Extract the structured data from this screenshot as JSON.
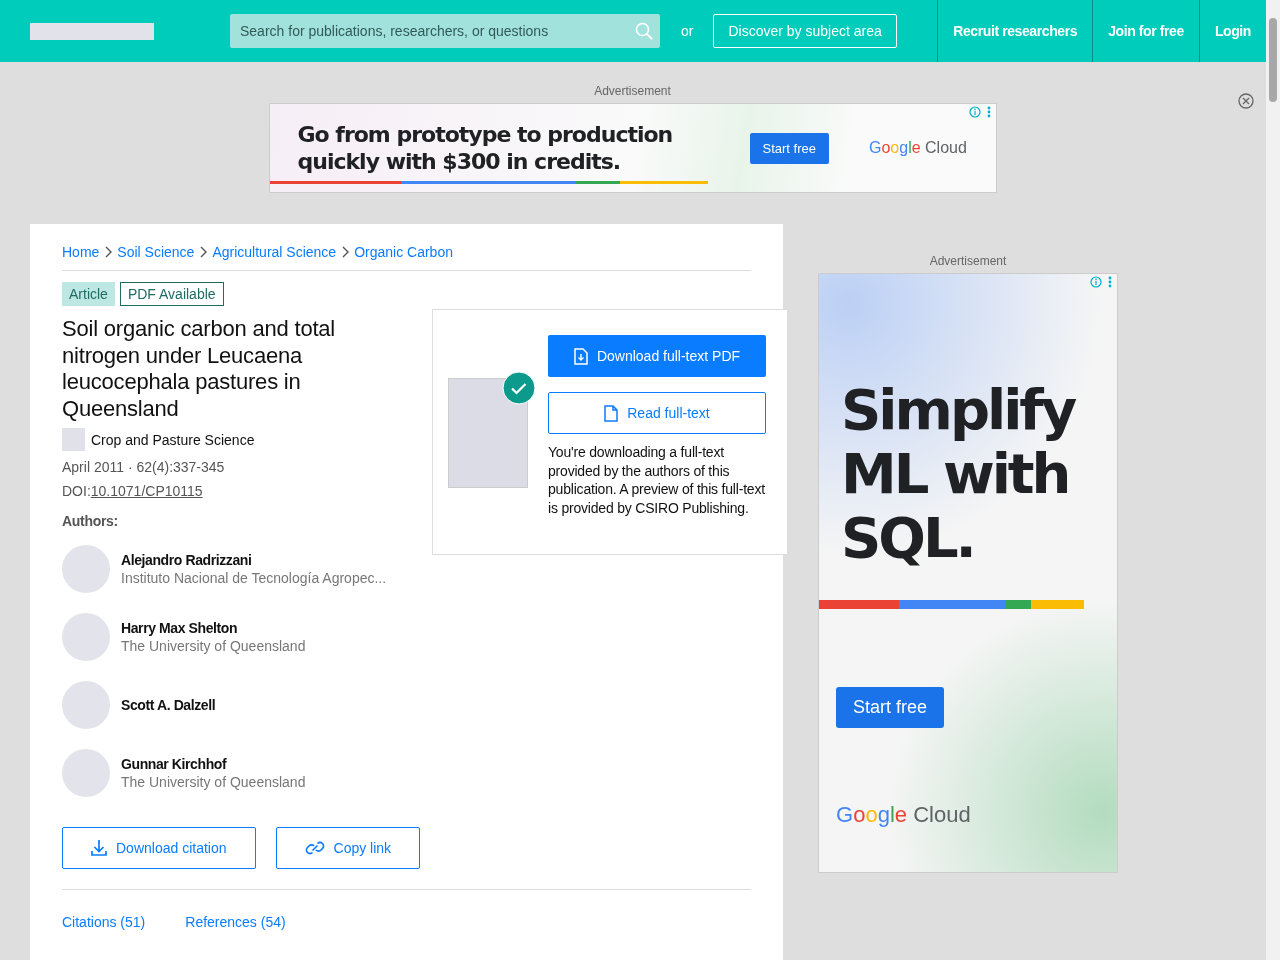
{
  "header": {
    "search": {
      "placeholder": "Search for publications, researchers, or questions"
    },
    "or_label": "or",
    "discover_button": "Discover by subject area",
    "nav": [
      "Recruit researchers",
      "Join for free",
      "Login"
    ]
  },
  "top_ad": {
    "label": "Advertisement",
    "headline": [
      "Go from prototype to production",
      "quickly with $300 in credits."
    ],
    "button": "Start free",
    "logo": [
      "Google",
      "Cloud"
    ]
  },
  "breadcrumbs": [
    "Home",
    "Soil Science",
    "Agricultural Science",
    "Organic Carbon"
  ],
  "tags": [
    {
      "label": "Article",
      "kind": "filled"
    },
    {
      "label": "PDF Available",
      "kind": "outline"
    }
  ],
  "title": "Soil organic carbon and total nitrogen under Leucaena leucocephala pastures in Queensland",
  "journal": "Crop and Pasture Science",
  "date_line": "April 2011 · 62(4):337-345",
  "doi": {
    "label": "DOI:",
    "value": "10.1071/CP10115"
  },
  "authors_heading": "Authors:",
  "authors": [
    {
      "name": "Alejandro Radrizzani",
      "affiliation": "Instituto Nacional de Tecnología Agropec..."
    },
    {
      "name": "Harry Max Shelton",
      "affiliation": "The University of Queensland"
    },
    {
      "name": "Scott A. Dalzell"
    },
    {
      "name": "Gunnar Kirchhof",
      "affiliation": "The University of Queensland"
    }
  ],
  "actions": [
    "Download citation",
    "Copy link"
  ],
  "tabs": [
    {
      "label": "Citations (51)",
      "selected": false
    },
    {
      "label": "References (54)",
      "selected": false
    }
  ],
  "download_panel": {
    "checked": true,
    "primary_button": "Download full-text PDF",
    "secondary_button": "Read full-text",
    "note": "You're downloading a full-text provided by the authors of this publication. A preview of this full-text is provided by CSIRO Publishing."
  },
  "side_ad": {
    "label": "Advertisement",
    "headline": [
      "Simplify",
      "ML with",
      "SQL."
    ],
    "button": "Start free",
    "logo": [
      "Google",
      "Cloud"
    ]
  }
}
